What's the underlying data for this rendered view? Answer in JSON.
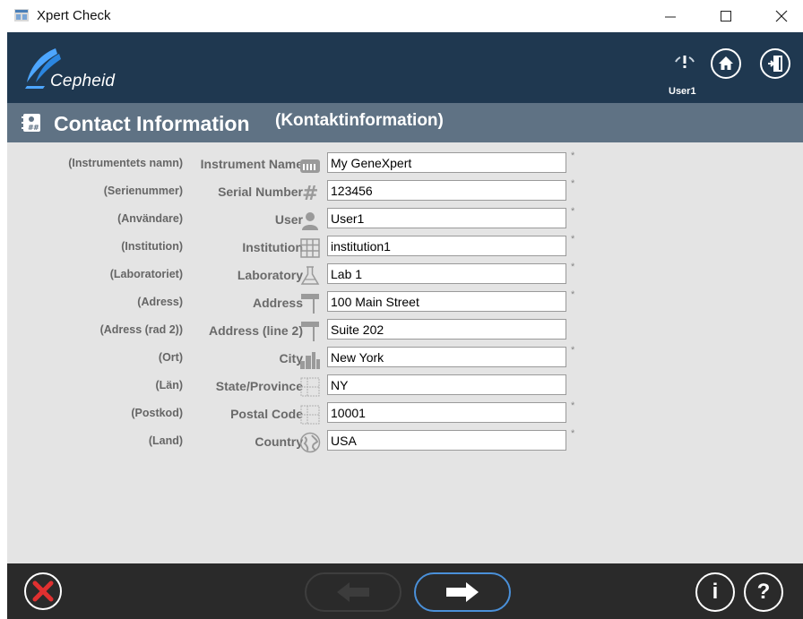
{
  "window": {
    "title": "Xpert Check",
    "app_icon": "xpert-app-icon",
    "controls": [
      "minimize-icon",
      "maximize-icon",
      "close-icon"
    ]
  },
  "header": {
    "logo_text": "Cepheid",
    "user": "User1",
    "user_icon": "wifi-alert-icon",
    "home_icon": "home-icon",
    "exit_icon": "exit-door-icon",
    "colors": {
      "header_bg": "#1f3850",
      "section_bg": "#5f7284"
    }
  },
  "section": {
    "title": "Contact Information",
    "subtitle": "(Kontaktinformation)",
    "icon": "contact-card-icon"
  },
  "form": {
    "required_mark": "*",
    "fields": [
      {
        "label_sv": "(Instrumentets namn)",
        "label_en": "Instrument Name",
        "icon": "instrument-icon",
        "value": "My GeneXpert",
        "required": true
      },
      {
        "label_sv": "(Serienummer)",
        "label_en": "Serial Number",
        "icon": "hash-icon",
        "value": "123456",
        "required": true
      },
      {
        "label_sv": "(Användare)",
        "label_en": "User",
        "icon": "person-icon",
        "value": "User1",
        "required": true
      },
      {
        "label_sv": "(Institution)",
        "label_en": "Institution",
        "icon": "building-icon",
        "value": "institution1",
        "required": true
      },
      {
        "label_sv": "(Laboratoriet)",
        "label_en": "Laboratory",
        "icon": "flask-icon",
        "value": "Lab 1",
        "required": true
      },
      {
        "label_sv": "(Adress)",
        "label_en": "Address",
        "icon": "street-sign-icon",
        "value": "100 Main Street",
        "required": true
      },
      {
        "label_sv": "(Adress (rad 2))",
        "label_en": "Address (line 2)",
        "icon": "street-sign-icon",
        "value": "Suite 202",
        "required": false
      },
      {
        "label_sv": "(Ort)",
        "label_en": "City",
        "icon": "city-icon",
        "value": "New York",
        "required": true
      },
      {
        "label_sv": "(Län)",
        "label_en": "State/Province",
        "icon": "map-grid-icon",
        "value": "NY",
        "required": false
      },
      {
        "label_sv": "(Postkod)",
        "label_en": "Postal Code",
        "icon": "map-grid-icon",
        "value": "10001",
        "required": true
      },
      {
        "label_sv": "(Land)",
        "label_en": "Country",
        "icon": "globe-icon",
        "value": "USA",
        "required": true
      }
    ]
  },
  "footer": {
    "cancel_icon": "cancel-x-icon",
    "back_icon": "arrow-left-icon",
    "next_icon": "arrow-right-icon",
    "info_label": "i",
    "help_label": "?"
  }
}
